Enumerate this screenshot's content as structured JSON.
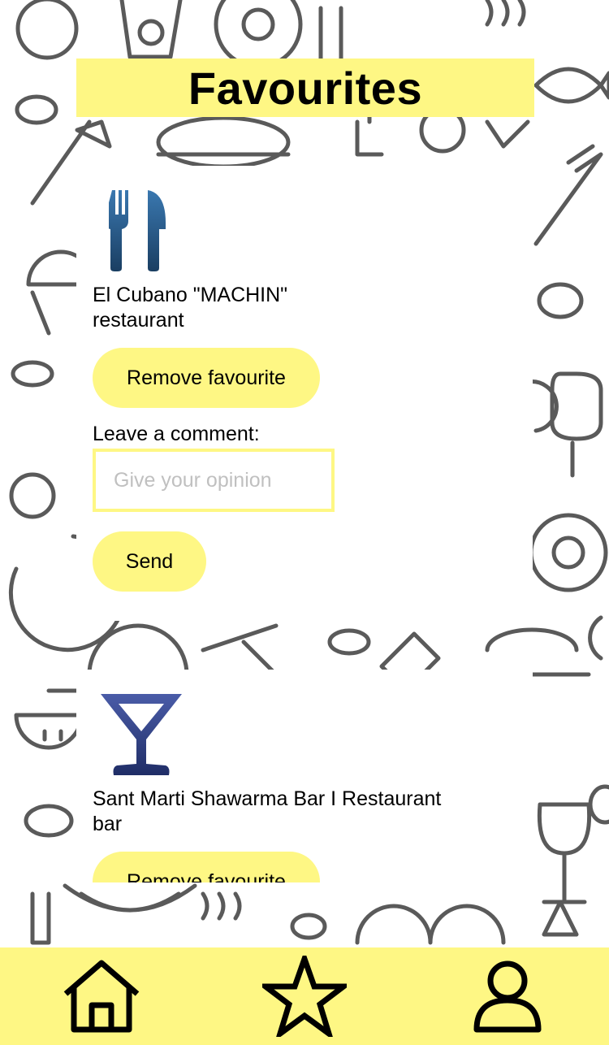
{
  "header": {
    "title": "Favourites"
  },
  "favourites": [
    {
      "icon": "restaurant-cutlery-icon",
      "name": "El Cubano \"MACHIN\"",
      "type": "restaurant",
      "remove_label": "Remove favourite",
      "comment_label": "Leave a comment:",
      "comment_placeholder": "Give your opinion",
      "comment_value": "",
      "send_label": "Send"
    },
    {
      "icon": "bar-cocktail-icon",
      "name": "Sant Marti Shawarma Bar I Restaurant",
      "type": "bar",
      "remove_label": "Remove favourite"
    }
  ],
  "tabbar": {
    "items": [
      {
        "icon": "home-icon"
      },
      {
        "icon": "star-icon"
      },
      {
        "icon": "user-icon"
      }
    ]
  },
  "colors": {
    "accent": "#fef784",
    "icon_blue": "#1f4e7a",
    "text": "#000000"
  }
}
